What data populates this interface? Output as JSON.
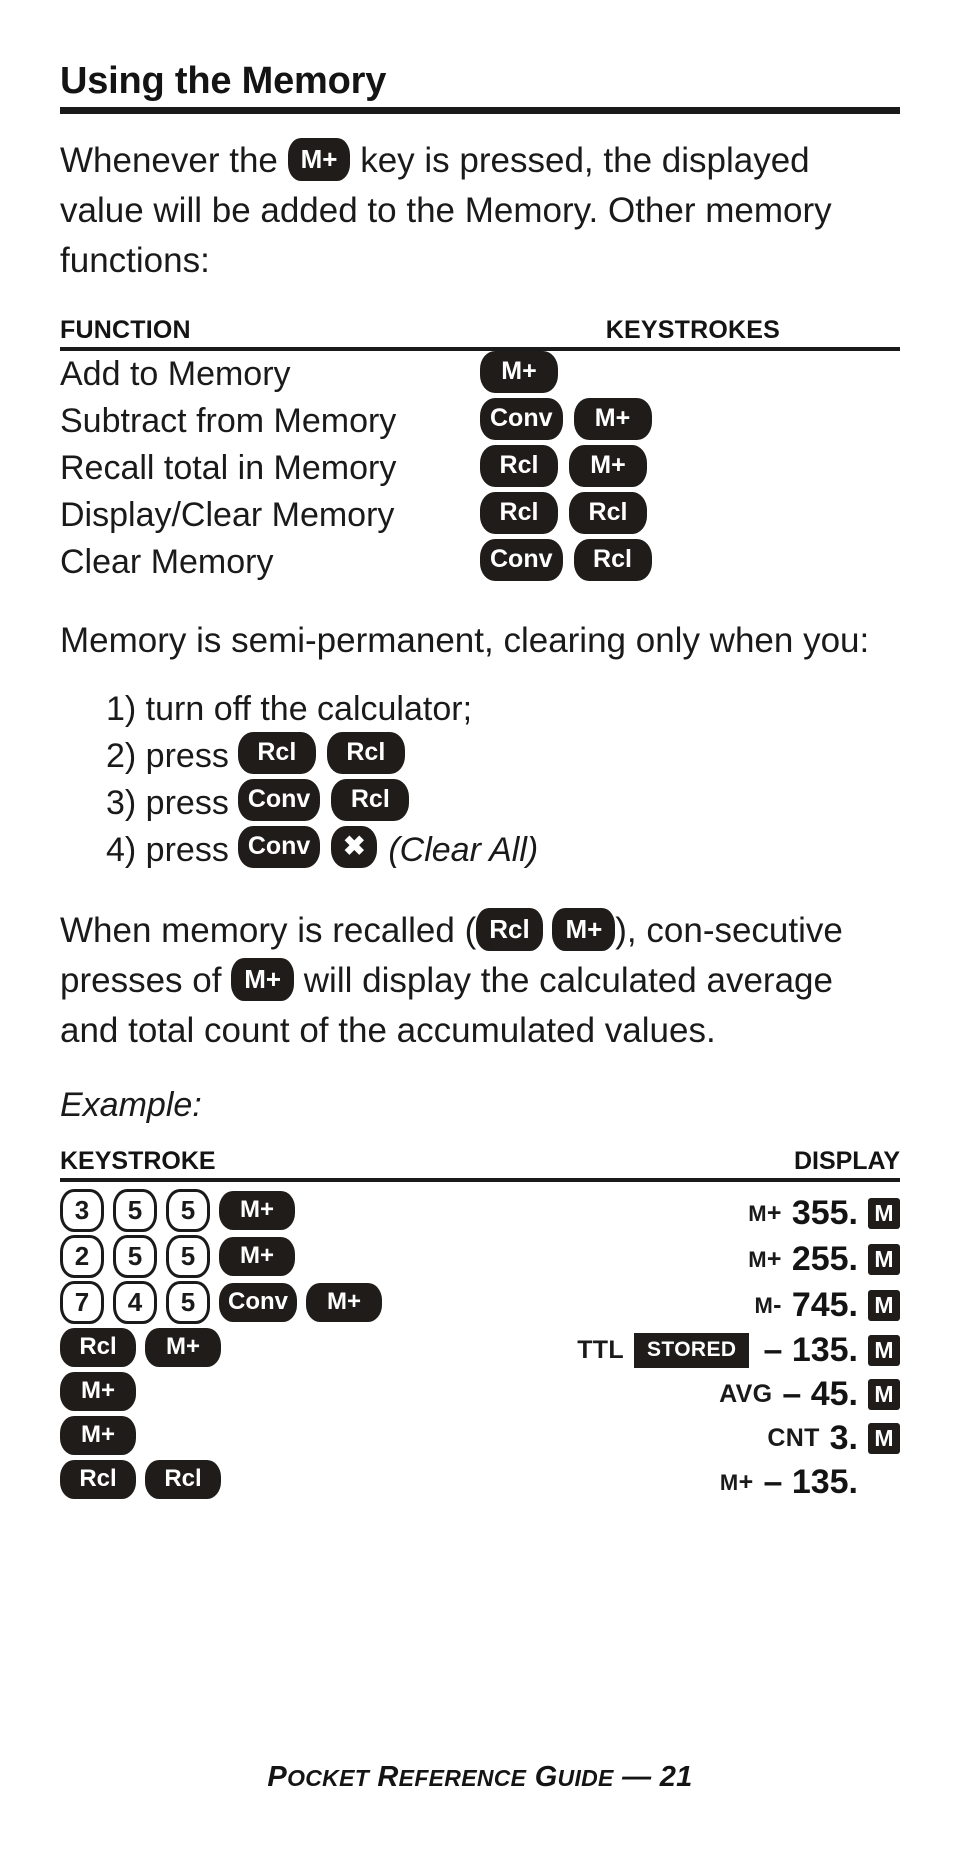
{
  "section": {
    "title": "Using the Memory"
  },
  "intro": {
    "part1": "Whenever the",
    "key": "M+",
    "part2": "key is pressed, the displayed value will be added to the Memory. Other memory functions:"
  },
  "function_table": {
    "headers": {
      "function": "FUNCTION",
      "keystrokes": "KEYSTROKES"
    },
    "rows": [
      {
        "name": "Add to Memory",
        "keys": [
          "M+"
        ]
      },
      {
        "name": "Subtract from Memory",
        "keys": [
          "Conv",
          "M+"
        ]
      },
      {
        "name": "Recall total in Memory",
        "keys": [
          "Rcl",
          "M+"
        ]
      },
      {
        "name": "Display/Clear Memory",
        "keys": [
          "Rcl",
          "Rcl"
        ]
      },
      {
        "name": "Clear Memory",
        "keys": [
          "Conv",
          "Rcl"
        ]
      }
    ]
  },
  "semi_permanent": {
    "text": "Memory is semi-permanent, clearing only when you:"
  },
  "clear_list": [
    {
      "label": "1) turn off the calculator;",
      "keys": [],
      "note": ""
    },
    {
      "label": "2) press",
      "keys": [
        "Rcl",
        "Rcl"
      ],
      "note": ""
    },
    {
      "label": "3) press",
      "keys": [
        "Conv",
        "Rcl"
      ],
      "note": ""
    },
    {
      "label": "4) press",
      "keys": [
        "Conv",
        "✖"
      ],
      "note": "(Clear All)"
    }
  ],
  "recall_para": {
    "part1": "When memory is recalled (",
    "key1": "Rcl",
    "key2": "M+",
    "part2": "), con-secutive presses of",
    "key3": "M+",
    "part3": "will display the calculated average and total count of the accumulated values."
  },
  "example": {
    "label": "Example:",
    "headers": {
      "keystroke": "KEYSTROKE",
      "display": "DISPLAY"
    },
    "rows": [
      {
        "keys": [
          {
            "t": "3",
            "style": "digit"
          },
          {
            "t": "5",
            "style": "digit"
          },
          {
            "t": "5",
            "style": "digit"
          },
          {
            "t": "M+",
            "style": "fn"
          }
        ],
        "annotation": "M+",
        "annotation_smallcap": true,
        "stored": false,
        "value": "355.",
        "memory_flag": "M"
      },
      {
        "keys": [
          {
            "t": "2",
            "style": "digit"
          },
          {
            "t": "5",
            "style": "digit"
          },
          {
            "t": "5",
            "style": "digit"
          },
          {
            "t": "M+",
            "style": "fn"
          }
        ],
        "annotation": "M+",
        "annotation_smallcap": true,
        "stored": false,
        "value": "255.",
        "memory_flag": "M"
      },
      {
        "keys": [
          {
            "t": "7",
            "style": "digit"
          },
          {
            "t": "4",
            "style": "digit"
          },
          {
            "t": "5",
            "style": "digit"
          },
          {
            "t": "Conv",
            "style": "fn"
          },
          {
            "t": "M+",
            "style": "fn"
          }
        ],
        "annotation": "M-",
        "annotation_smallcap": true,
        "stored": false,
        "value": "745.",
        "memory_flag": "M"
      },
      {
        "keys": [
          {
            "t": "Rcl",
            "style": "fn"
          },
          {
            "t": "M+",
            "style": "fn"
          }
        ],
        "annotation": "TTL",
        "annotation_smallcap": false,
        "stored": true,
        "stored_label": "STORED",
        "value": "– 135.",
        "memory_flag": "M"
      },
      {
        "keys": [
          {
            "t": "M+",
            "style": "fn"
          }
        ],
        "annotation": "AVG",
        "annotation_smallcap": false,
        "stored": false,
        "value": "– 45.",
        "memory_flag": "M"
      },
      {
        "keys": [
          {
            "t": "M+",
            "style": "fn"
          }
        ],
        "annotation": "CNT",
        "annotation_smallcap": false,
        "stored": false,
        "value": "3.",
        "memory_flag": "M"
      },
      {
        "keys": [
          {
            "t": "Rcl",
            "style": "fn"
          },
          {
            "t": "Rcl",
            "style": "fn"
          }
        ],
        "annotation": "M+",
        "annotation_smallcap": true,
        "stored": false,
        "value": "– 135.",
        "memory_flag": ""
      }
    ]
  },
  "footer": {
    "text_lead": "P",
    "text": "POCKET REFERENCE GUIDE — 21",
    "page": "21"
  },
  "colors": {
    "ink": "#1a1a1a",
    "key_fill": "#1f1c1a",
    "paper": "#ffffff"
  }
}
